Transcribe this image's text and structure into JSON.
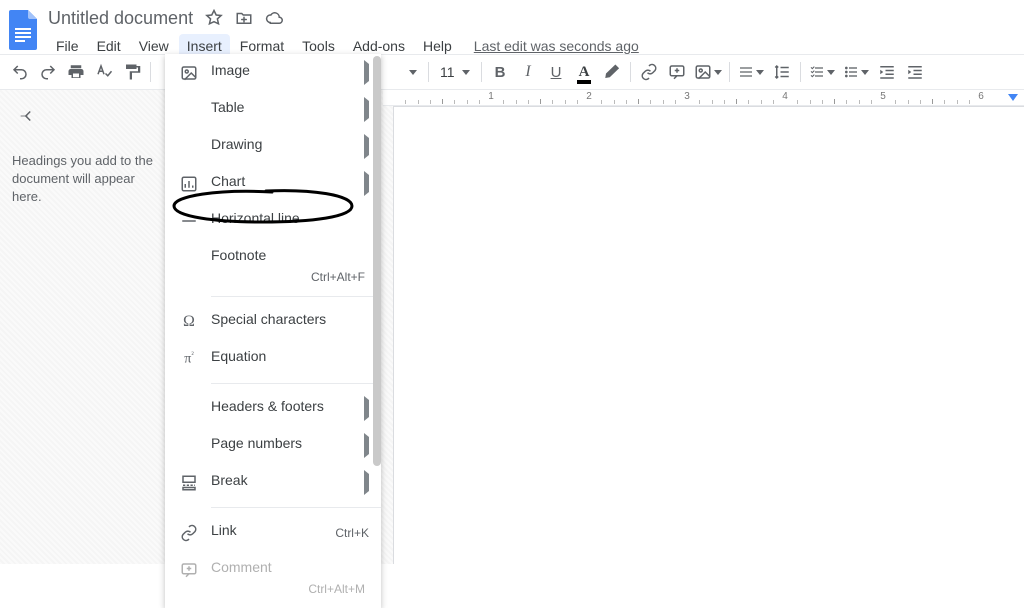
{
  "title": {
    "doc_title": "Untitled document"
  },
  "menubar": {
    "items": [
      "File",
      "Edit",
      "View",
      "Insert",
      "Format",
      "Tools",
      "Add-ons",
      "Help"
    ],
    "open_index": 3,
    "last_edit": "Last edit was seconds ago"
  },
  "toolbar": {
    "font_size": "11"
  },
  "outline": {
    "tip": "Headings you add to the document will appear here."
  },
  "ruler": {
    "numbers": [
      "1",
      "2",
      "3",
      "4",
      "5",
      "6"
    ]
  },
  "insert_menu": {
    "items": [
      {
        "icon": "image-icon",
        "label": "Image",
        "submenu": true
      },
      {
        "icon": "table-icon",
        "label": "Table",
        "submenu": true
      },
      {
        "icon": "drawing-icon",
        "label": "Drawing",
        "submenu": true
      },
      {
        "icon": "chart-icon",
        "label": "Chart",
        "submenu": true
      },
      {
        "icon": "hr-icon",
        "label": "Horizontal line",
        "submenu": false,
        "highlight": true
      },
      {
        "icon": "footnote-icon",
        "label": "Footnote",
        "submenu": false,
        "shortcut": "Ctrl+Alt+F",
        "sep_after": true
      },
      {
        "icon": "omega-icon",
        "label": "Special characters",
        "submenu": false
      },
      {
        "icon": "pi-icon",
        "label": "Equation",
        "submenu": false,
        "sep_after": true
      },
      {
        "icon": "headers-icon",
        "label": "Headers & footers",
        "submenu": true
      },
      {
        "icon": "pagenum-icon",
        "label": "Page numbers",
        "submenu": true
      },
      {
        "icon": "break-icon",
        "label": "Break",
        "submenu": true,
        "sep_after": true
      },
      {
        "icon": "link-icon",
        "label": "Link",
        "submenu": false,
        "shortcut": "Ctrl+K"
      },
      {
        "icon": "comment-icon",
        "label": "Comment",
        "submenu": false,
        "shortcut": "Ctrl+Alt+M",
        "disabled": true
      }
    ]
  }
}
